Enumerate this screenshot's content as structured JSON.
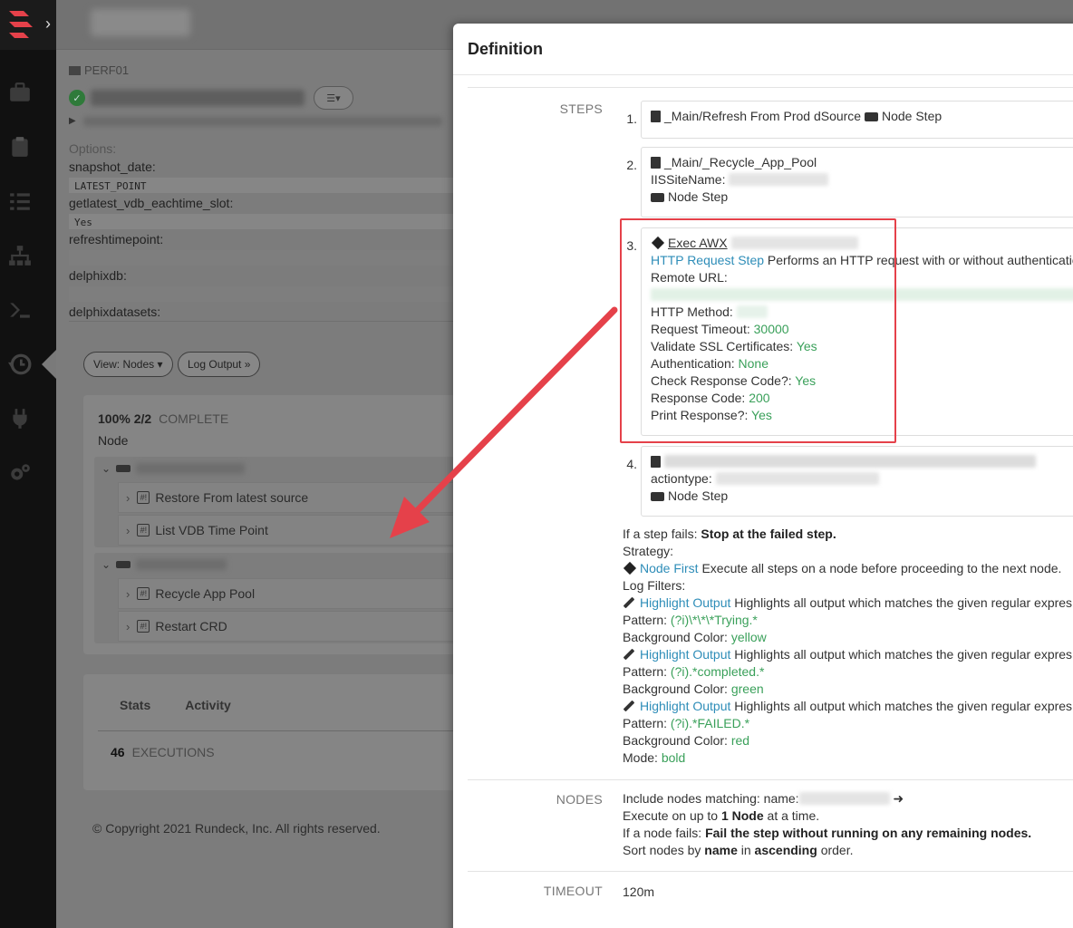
{
  "nav": {
    "items": [
      "briefcase-icon",
      "clipboard-icon",
      "list-check-icon",
      "sitemap-icon",
      "terminal-icon",
      "history-icon",
      "plug-icon",
      "gears-icon"
    ]
  },
  "background": {
    "project": "PERF01",
    "options_label": "Options:",
    "options": [
      {
        "name": "snapshot_date:",
        "value": "LATEST_POINT"
      },
      {
        "name": "getlatest_vdb_eachtime_slot:",
        "value": "Yes"
      },
      {
        "name": "refreshtimepoint:",
        "value": ""
      },
      {
        "name": "delphixdb:",
        "value": ""
      },
      {
        "name": "delphixdatasets:",
        "value": ""
      }
    ],
    "view_nodes_btn": "View: Nodes ▾",
    "log_output_btn": "Log Output »",
    "progress_pct": "100% 2/2",
    "progress_status": "COMPLETE",
    "node_label": "Node",
    "node_groups": [
      {
        "steps": [
          "Restore From latest source",
          "List VDB Time Point"
        ]
      },
      {
        "steps": [
          "Recycle App Pool",
          "Restart CRD"
        ]
      }
    ],
    "tabs": [
      "Stats",
      "Activity"
    ],
    "executions_count": "46",
    "executions_label": "EXECUTIONS",
    "copyright": "© Copyright 2021 Rundeck, Inc. All rights reserved."
  },
  "modal": {
    "title": "Definition",
    "steps_label": "STEPS",
    "steps": [
      {
        "num": "1.",
        "job": "_Main/Refresh From Prod dSource",
        "type": "Node Step"
      },
      {
        "num": "2.",
        "job": "_Main/_Recycle_App_Pool",
        "param": "IISSiteName:",
        "type": "Node Step"
      },
      {
        "num": "3.",
        "name": "Exec AWX",
        "plugin": "HTTP Request Step",
        "plugin_desc": "Performs an HTTP request with or without authenticatio",
        "remote_url_label": "Remote URL:",
        "http_method_label": "HTTP Method:",
        "timeout_label": "Request Timeout:",
        "timeout_value": "30000",
        "ssl_label": "Validate SSL Certificates:",
        "ssl_value": "Yes",
        "auth_label": "Authentication:",
        "auth_value": "None",
        "check_label": "Check Response Code?:",
        "check_value": "Yes",
        "code_label": "Response Code:",
        "code_value": "200",
        "print_label": "Print Response?:",
        "print_value": "Yes"
      },
      {
        "num": "4.",
        "param": "actiontype:",
        "type": "Node Step"
      }
    ],
    "fail_prefix": "If a step fails:",
    "fail_value": "Stop at the failed step.",
    "strategy_label": "Strategy:",
    "strategy_name": "Node First",
    "strategy_desc": "Execute all steps on a node before proceeding to the next node.",
    "log_filters_label": "Log Filters:",
    "filters": [
      {
        "name": "Highlight Output",
        "desc": "Highlights all output which matches the given regular expres",
        "pattern_label": "Pattern:",
        "pattern": "(?i)\\*\\*\\*Trying.*",
        "color_label": "Background Color:",
        "color": "yellow"
      },
      {
        "name": "Highlight Output",
        "desc": "Highlights all output which matches the given regular expres",
        "pattern_label": "Pattern:",
        "pattern": "(?i).*completed.*",
        "color_label": "Background Color:",
        "color": "green"
      },
      {
        "name": "Highlight Output",
        "desc": "Highlights all output which matches the given regular expres",
        "pattern_label": "Pattern:",
        "pattern": "(?i).*FAILED.*",
        "color_label": "Background Color:",
        "color": "red",
        "mode_label": "Mode:",
        "mode": "bold"
      }
    ],
    "nodes_label": "NODES",
    "nodes_include": "Include nodes matching: name:",
    "exec_prefix": "Execute on up to",
    "exec_count": "1 Node",
    "exec_suffix": "at a time.",
    "node_fail_prefix": "If a node fails:",
    "node_fail_value": "Fail the step without running on any remaining nodes.",
    "sort_prefix": "Sort nodes by",
    "sort_field": "name",
    "sort_mid": "in",
    "sort_order": "ascending",
    "sort_suffix": "order.",
    "timeout_label": "TIMEOUT",
    "timeout_value": "120m"
  },
  "annotation_color": "#e5414a"
}
